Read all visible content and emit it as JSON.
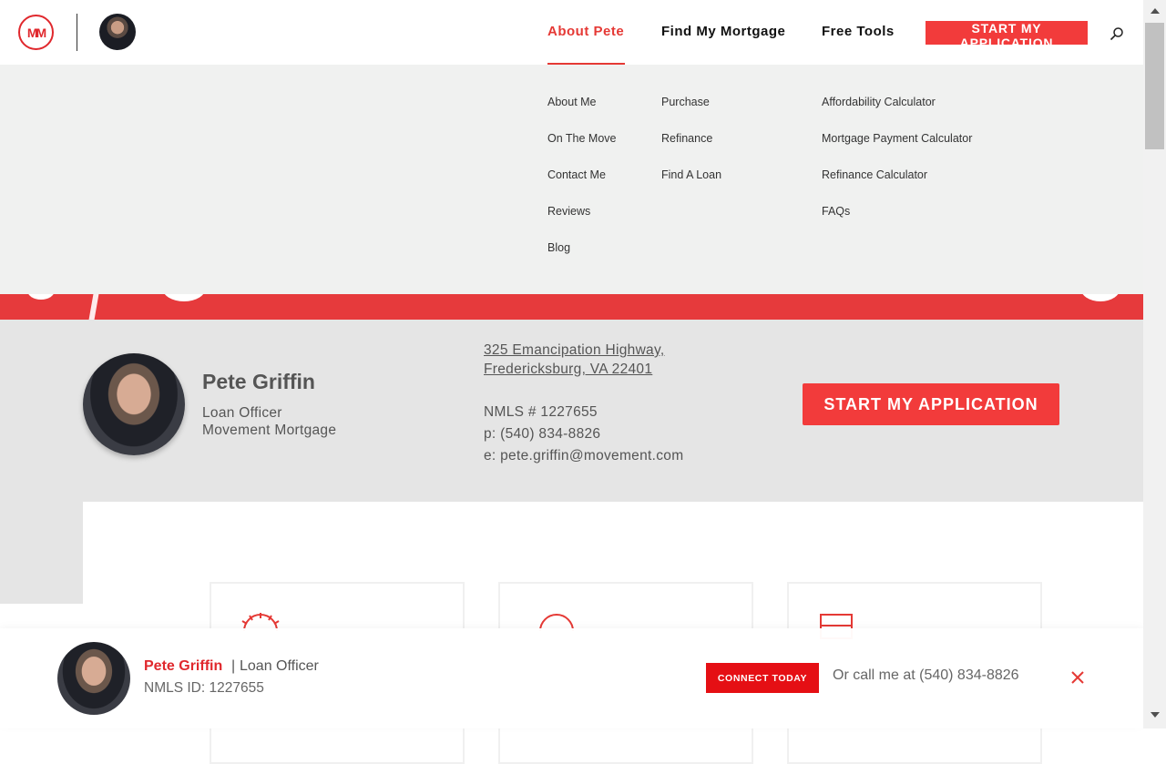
{
  "header": {
    "logo_text": "MM",
    "nav": [
      {
        "label": "About Pete",
        "active": true
      },
      {
        "label": "Find My Mortgage"
      },
      {
        "label": "Free Tools"
      }
    ],
    "apply_button": "START MY APPLICATION",
    "search_icon": "search-icon"
  },
  "dropdown": {
    "col1": [
      "About Me",
      "On The Move",
      "Contact Me",
      "Reviews",
      "Blog"
    ],
    "col2": [
      "Purchase",
      "Refinance",
      "Find A Loan"
    ],
    "col3": [
      "Affordability Calculator",
      "Mortgage Payment Calculator",
      "Refinance Calculator",
      "FAQs"
    ]
  },
  "profile": {
    "name": "Pete Griffin",
    "title": "Loan Officer",
    "company": "Movement Mortgage",
    "address_line1": "325 Emancipation Highway,",
    "address_line2": "Fredericksburg, VA 22401",
    "nmls": "NMLS # 1227655",
    "phone": "p: (540) 834-8826",
    "email": "e: pete.griffin@movement.com",
    "apply_button": "START MY APPLICATION"
  },
  "sticky": {
    "name": "Pete Griffin",
    "separator": "|",
    "role": "Loan Officer",
    "nmls": "NMLS ID: 1227655",
    "connect_button": "CONNECT TODAY",
    "call_text": "Or call me at (540) 834-8826",
    "close_icon": "close-icon"
  },
  "colors": {
    "accent": "#e53935",
    "button": "#f23b3b",
    "connect": "#e50f14",
    "dropdown_bg": "#f0f1f0",
    "profile_bg": "#e5e5e5"
  }
}
